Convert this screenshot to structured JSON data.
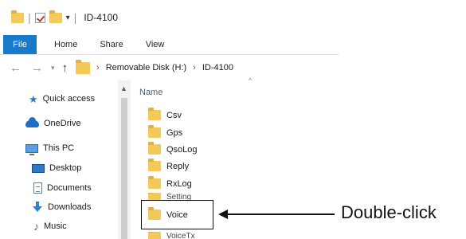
{
  "window": {
    "title": "ID-4100"
  },
  "ribbon": {
    "tabs": [
      "File",
      "Home",
      "Share",
      "View"
    ]
  },
  "address": {
    "segments": [
      "Removable Disk (H:)",
      "ID-4100"
    ]
  },
  "nav": [
    {
      "label": "Quick access",
      "icon": "star-icon"
    },
    {
      "label": "OneDrive",
      "icon": "cloud-icon"
    },
    {
      "label": "This PC",
      "icon": "pc-icon"
    },
    {
      "label": "Desktop",
      "icon": "desktop-icon"
    },
    {
      "label": "Documents",
      "icon": "documents-icon"
    },
    {
      "label": "Downloads",
      "icon": "download-icon"
    },
    {
      "label": "Music",
      "icon": "music-icon"
    }
  ],
  "list": {
    "column_header": "Name",
    "items": [
      "Csv",
      "Gps",
      "QsoLog",
      "Reply",
      "RxLog",
      "Setting",
      "Voice",
      "VoiceTx"
    ]
  },
  "annotation": {
    "label": "Double-click"
  },
  "colors": {
    "accent": "#1979ca",
    "folder": "#f3c95a"
  }
}
